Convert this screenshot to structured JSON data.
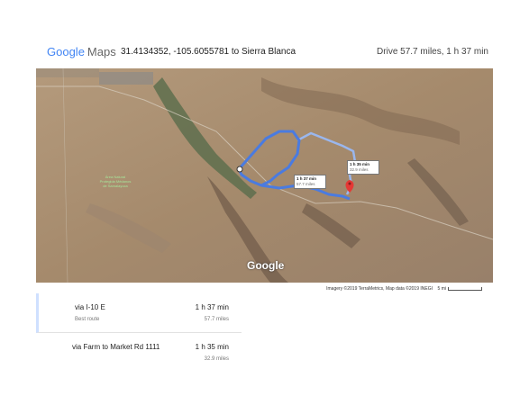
{
  "header": {
    "logo_google": "Google",
    "logo_maps": "Maps",
    "route_title": "31.4134352, -105.6055781 to Sierra Blanca",
    "trip_summary": "Drive 57.7 miles, 1 h 37 min"
  },
  "map": {
    "watermark": "Google",
    "callouts": [
      {
        "time": "1 h 37 min",
        "distance": "57.7 miles"
      },
      {
        "time": "1 h 35 min",
        "distance": "32.9 miles"
      }
    ],
    "place_labels": [
      "Área Natural Protegida Médanos de Samalayuca"
    ],
    "attribution": "Imagery ©2019 TerraMetrics, Map data ©2019 INEGI",
    "scale_label": "5 mi",
    "colors": {
      "route_primary": "#4a7be0",
      "route_alt": "#9ab7ee",
      "terrain": "#a88e72"
    }
  },
  "routes": [
    {
      "via": "via I-10 E",
      "note": "Best route",
      "duration": "1 h 37 min",
      "distance": "57.7 miles",
      "selected": true
    },
    {
      "via": "via Farm to Market Rd 1111",
      "note": "",
      "duration": "1 h 35 min",
      "distance": "32.9 miles",
      "selected": false
    }
  ]
}
